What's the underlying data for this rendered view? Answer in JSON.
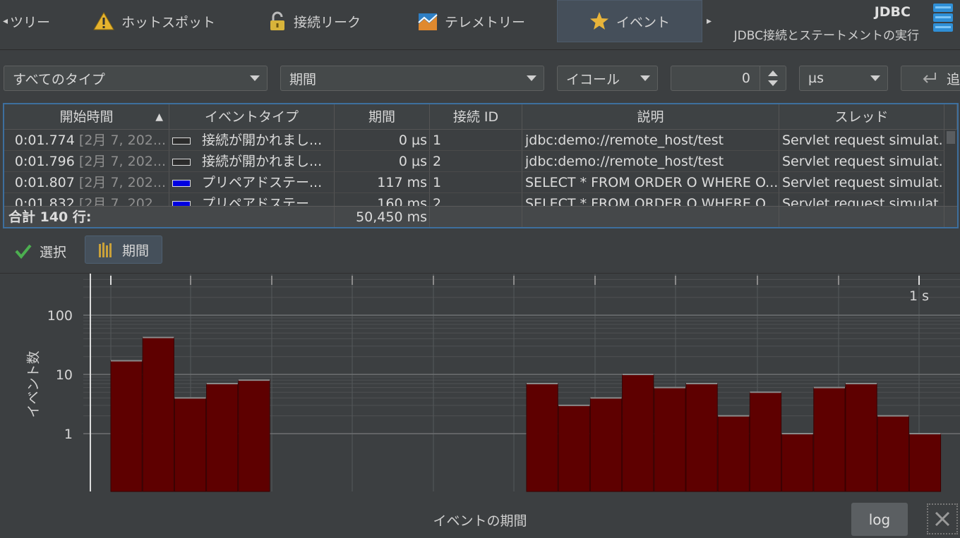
{
  "tabs": [
    {
      "label": "ツリー",
      "icon": "tree-icon"
    },
    {
      "label": "ホットスポット",
      "icon": "warning-icon"
    },
    {
      "label": "接続リーク",
      "icon": "lock-icon"
    },
    {
      "label": "テレメトリー",
      "icon": "telemetry-icon"
    },
    {
      "label": "イベント",
      "icon": "star-icon",
      "active": true
    }
  ],
  "header": {
    "title": "JDBC",
    "subtitle": "JDBC接続とステートメントの実行"
  },
  "filters": {
    "type": "すべてのタイプ",
    "field": "期間",
    "operator": "イコール",
    "value": "0",
    "unit": "µs",
    "add_label": "追"
  },
  "table": {
    "columns": [
      "開始時間",
      "イベントタイプ",
      "期間",
      "接続 ID",
      "説明",
      "スレッド"
    ],
    "rows": [
      {
        "time": "0:01.774",
        "date": "[2月 7, 202...",
        "type": "接続が開かれまし...",
        "swatch": "#2b2b2b",
        "duration": "0 µs",
        "conn": "1",
        "desc": "jdbc:demo://remote_host/test",
        "thread": "Servlet request simulat..."
      },
      {
        "time": "0:01.796",
        "date": "[2月 7, 202...",
        "type": "接続が開かれまし...",
        "swatch": "#2b2b2b",
        "duration": "0 µs",
        "conn": "2",
        "desc": "jdbc:demo://remote_host/test",
        "thread": "Servlet request simulat..."
      },
      {
        "time": "0:01.807",
        "date": "[2月 7, 202...",
        "type": "プリペアドステー...",
        "swatch": "#0000e0",
        "duration": "117 ms",
        "conn": "1",
        "desc": "SELECT * FROM ORDER O WHERE O....",
        "thread": "Servlet request simulat..."
      },
      {
        "time": "0:01.832",
        "date": "[2月 7, 202...",
        "type": "プリペアドステー...",
        "swatch": "#0000e0",
        "duration": "160 ms",
        "conn": "2",
        "desc": "SELECT * FROM ORDER O WHERE O....",
        "thread": "Servlet request simulat..."
      }
    ],
    "total_label": "合計 140 行:",
    "total_duration": "50,450 ms"
  },
  "chart_controls": {
    "select_label": "選択",
    "duration_label": "期間"
  },
  "chart_data": {
    "type": "bar",
    "xlabel": "イベントの期間",
    "ylabel": "イベント数",
    "y_scale": "log",
    "y_ticks": [
      "1",
      "10",
      "100"
    ],
    "x_tick_label": "1 s",
    "bar_color": "#5e0000",
    "groups": [
      {
        "values": [
          17,
          42,
          4,
          7,
          8
        ]
      },
      {
        "values": [
          7,
          3,
          4,
          10,
          6,
          7,
          2,
          5,
          1,
          6,
          7,
          2,
          1
        ]
      }
    ]
  },
  "buttons": {
    "log": "log"
  }
}
